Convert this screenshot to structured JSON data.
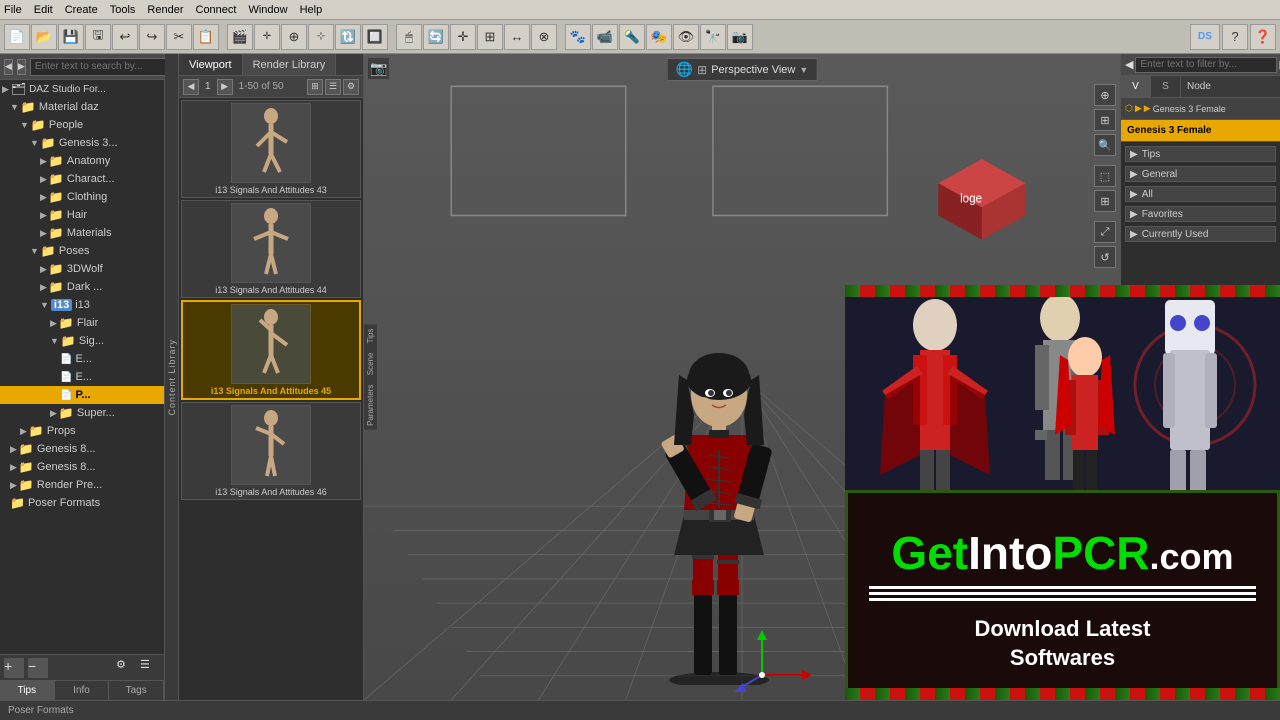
{
  "menubar": {
    "items": [
      "File",
      "Edit",
      "Create",
      "Tools",
      "Render",
      "Connect",
      "Window",
      "Help"
    ]
  },
  "toolbar": {
    "groups": [
      [
        "📄",
        "📂",
        "💾",
        "🖫",
        "↩",
        "↪",
        "✂",
        "📋"
      ],
      [
        "🎬",
        "⊹",
        "⊕",
        "🖊",
        "🔃",
        "🔲",
        "◫"
      ],
      [
        "🖱",
        "🔄",
        "✛",
        "⊞",
        "↔",
        "⊗"
      ],
      [
        "🐾",
        "📹",
        "🔦",
        "🎭",
        "👁",
        "🔭",
        "📷"
      ],
      [
        "D S",
        "?",
        "❓"
      ]
    ]
  },
  "left_panel": {
    "search_placeholder": "Enter text to search by...",
    "tree": [
      {
        "id": "daz-studio",
        "label": "DAZ Studio For...",
        "level": 0,
        "expanded": true,
        "type": "root"
      },
      {
        "id": "material-daz",
        "label": "Material daz",
        "level": 1,
        "expanded": true,
        "type": "folder"
      },
      {
        "id": "people",
        "label": "People",
        "level": 2,
        "expanded": true,
        "type": "folder"
      },
      {
        "id": "genesis3",
        "label": "Genesis 3...",
        "level": 3,
        "expanded": true,
        "type": "folder"
      },
      {
        "id": "anatomy",
        "label": "Anatomy",
        "level": 4,
        "expanded": false,
        "type": "folder"
      },
      {
        "id": "charact",
        "label": "Charact...",
        "level": 4,
        "expanded": false,
        "type": "folder"
      },
      {
        "id": "clothing",
        "label": "Clothing",
        "level": 4,
        "expanded": false,
        "type": "folder"
      },
      {
        "id": "hair",
        "label": "Hair",
        "level": 4,
        "expanded": false,
        "type": "folder"
      },
      {
        "id": "materials",
        "label": "Materials",
        "level": 4,
        "expanded": false,
        "type": "folder"
      },
      {
        "id": "poses",
        "label": "Poses",
        "level": 3,
        "expanded": true,
        "type": "folder"
      },
      {
        "id": "3dwolf",
        "label": "3DWolf",
        "level": 4,
        "expanded": false,
        "type": "folder"
      },
      {
        "id": "dark",
        "label": "Dark ...",
        "level": 4,
        "expanded": false,
        "type": "folder"
      },
      {
        "id": "i13",
        "label": "i13",
        "level": 4,
        "expanded": true,
        "type": "folder",
        "special": true
      },
      {
        "id": "flair",
        "label": "Flair",
        "level": 5,
        "expanded": false,
        "type": "folder"
      },
      {
        "id": "sig",
        "label": "Sig...",
        "level": 5,
        "expanded": true,
        "type": "folder"
      },
      {
        "id": "e1",
        "label": "E...",
        "level": 6,
        "expanded": false,
        "type": "file"
      },
      {
        "id": "e2",
        "label": "E...",
        "level": 6,
        "expanded": false,
        "type": "file"
      },
      {
        "id": "p-selected",
        "label": "P...",
        "level": 6,
        "expanded": false,
        "type": "file",
        "selected": true
      },
      {
        "id": "super",
        "label": "Super...",
        "level": 5,
        "expanded": false,
        "type": "folder"
      },
      {
        "id": "props",
        "label": "Props",
        "level": 2,
        "expanded": false,
        "type": "folder"
      },
      {
        "id": "genesis8",
        "label": "Genesis 8...",
        "level": 1,
        "expanded": false,
        "type": "folder"
      },
      {
        "id": "genesis8b",
        "label": "Genesis 8...",
        "level": 1,
        "expanded": false,
        "type": "folder"
      },
      {
        "id": "render-pre",
        "label": "Render Pre...",
        "level": 1,
        "expanded": false,
        "type": "folder"
      },
      {
        "id": "poser-formats",
        "label": "Poser Formats",
        "level": 1,
        "expanded": false,
        "type": "folder"
      }
    ],
    "tabs": [
      "Tips",
      "Info",
      "Tags"
    ]
  },
  "content_library": {
    "tabs": [
      "Viewport",
      "Render Library"
    ],
    "active_tab": "Viewport",
    "nav": {
      "current": "1",
      "total": "50",
      "display": "1-50 of 50"
    },
    "thumbnails": [
      {
        "id": "thumb1",
        "label": "i13 Signals And Attitudes 43",
        "selected": false
      },
      {
        "id": "thumb2",
        "label": "i13 Signals And Attitudes 44",
        "selected": false
      },
      {
        "id": "thumb3",
        "label": "i13 Signals And Attitudes 45",
        "selected": true
      },
      {
        "id": "thumb4",
        "label": "i13 Signals And Attitudes 46",
        "selected": false
      }
    ]
  },
  "viewport": {
    "active_tab": "Viewport",
    "tabs": [
      "Viewport",
      "Render Library"
    ],
    "view_mode": "Perspective View",
    "perspective_label": "Perspective View"
  },
  "right_panel": {
    "search_placeholder": "Enter text to filter by...",
    "tabs_top": [
      "V",
      "S"
    ],
    "node_label": "Node",
    "breadcrumb": "Genesis 3 Female",
    "selected_label": "Genesis 3 Female",
    "sections": [
      "Tips",
      "General",
      "All",
      "Favorites",
      "Currently Used"
    ],
    "bottom_tabs": [
      "Parameters",
      "Scene"
    ],
    "side_labels": [
      "Tips",
      "Scene",
      "Parameters"
    ]
  },
  "statusbar": {
    "text": "Poser Formats"
  },
  "ad": {
    "get": "Get",
    "into": "Into",
    "pcr": "PCR",
    "dot_com": ".com",
    "download_line1": "Download Latest",
    "download_line2": "Softwares"
  }
}
